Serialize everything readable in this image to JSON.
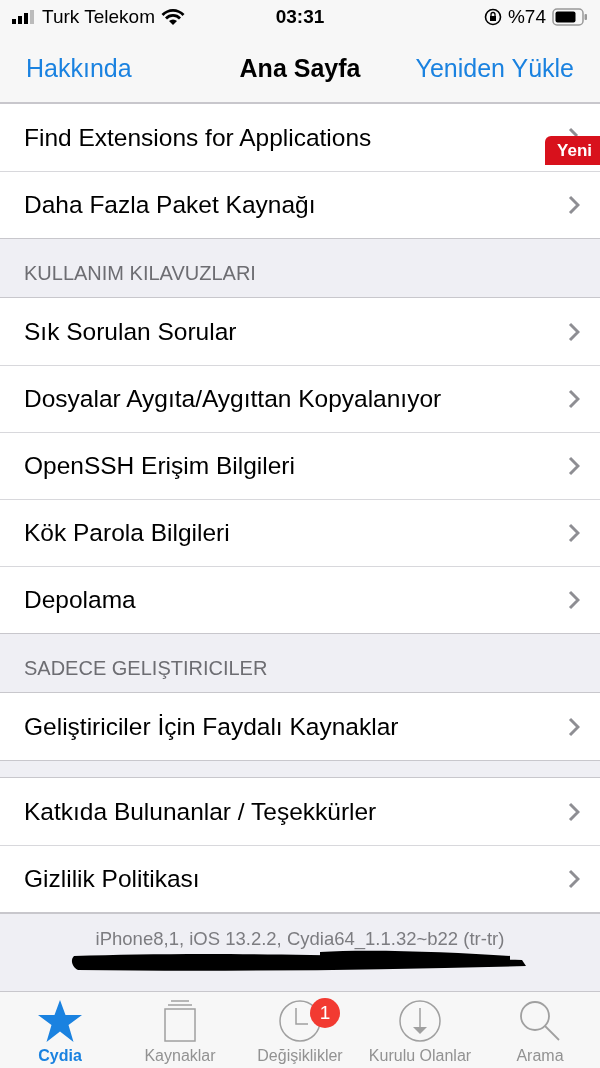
{
  "status_bar": {
    "carrier": "Turk Telekom",
    "time": "03:31",
    "battery": "%74"
  },
  "nav": {
    "left": "Hakkında",
    "title": "Ana Sayfa",
    "right": "Yeniden Yükle"
  },
  "sections": [
    {
      "rows": [
        {
          "label": "Find Extensions for Applications",
          "badge": "Yeni"
        },
        {
          "label": "Daha Fazla Paket Kaynağı"
        }
      ]
    },
    {
      "header": "KULLANIM KILAVUZLARI",
      "rows": [
        {
          "label": "Sık Sorulan Sorular"
        },
        {
          "label": "Dosyalar Aygıta/Aygıttan Kopyalanıyor"
        },
        {
          "label": "OpenSSH Erişim Bilgileri"
        },
        {
          "label": "Kök Parola Bilgileri"
        },
        {
          "label": "Depolama"
        }
      ]
    },
    {
      "header": "SADECE GELIŞTIRICILER",
      "rows": [
        {
          "label": "Geliştiriciler İçin Faydalı Kaynaklar"
        }
      ]
    },
    {
      "rows": [
        {
          "label": "Katkıda Bulunanlar / Teşekkürler"
        },
        {
          "label": "Gizlilik Politikası"
        }
      ]
    }
  ],
  "footer": "iPhone8,1, iOS 13.2.2, Cydia64_1.1.32~b22 (tr-tr)",
  "tabs": [
    {
      "label": "Cydia",
      "selected": true
    },
    {
      "label": "Kaynaklar",
      "selected": false
    },
    {
      "label": "Değişiklikler",
      "selected": false,
      "badge": "1"
    },
    {
      "label": "Kurulu Olanlar",
      "selected": false
    },
    {
      "label": "Arama",
      "selected": false
    }
  ]
}
